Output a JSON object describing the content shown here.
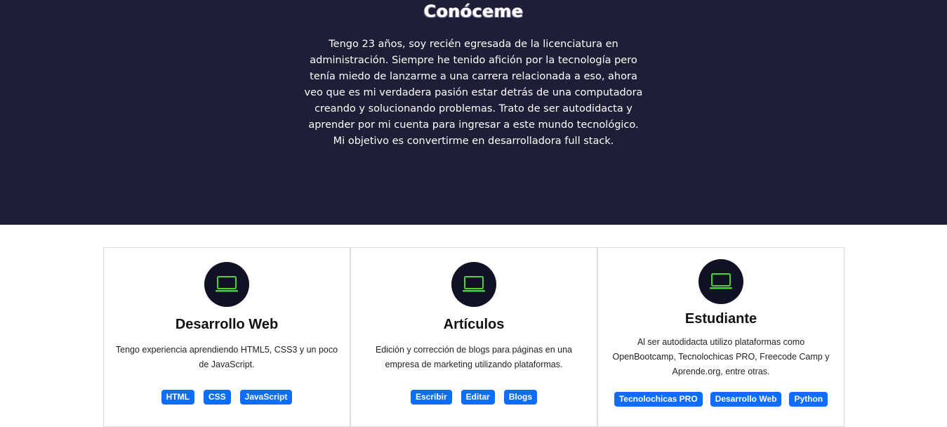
{
  "about": {
    "title": "Conóceme",
    "paragraph": "Tengo 23 años, soy recién egresada de la licenciatura en administración. Siempre he tenido afición por la tecnología pero tenía miedo de lanzarme a una carrera relacionada a eso, ahora veo que es mi verdadera pasión estar detrás de una computadora creando y solucionando problemas. Trato de ser autodidacta y aprender por mi cuenta para ingresar a este mundo tecnológico. Mi objetivo es convertirme en desarrolladora full stack."
  },
  "cards": [
    {
      "icon": "laptop-icon",
      "title": "Desarrollo Web",
      "text": "Tengo experiencia aprendiendo HTML5, CSS3 y un poco de JavaScript.",
      "tags": [
        "HTML",
        "CSS",
        "JavaScript"
      ]
    },
    {
      "icon": "laptop-icon",
      "title": "Artículos",
      "text": "Edición y corrección de blogs para páginas en una empresa de marketing utilizando plataformas.",
      "tags": [
        "Escribir",
        "Editar",
        "Blogs"
      ]
    },
    {
      "icon": "laptop-icon",
      "title": "Estudiante",
      "text": "Al ser autodidacta utilizo plataformas como OpenBootcamp, Tecnolochicas PRO, Freecode Camp y Aprende.org, entre otras.",
      "tags": [
        "Tecnolochicas PRO",
        "Desarrollo Web",
        "Python"
      ]
    }
  ],
  "colors": {
    "hero_bg": "#1e1f37",
    "icon_circle": "#0f1125",
    "icon_accent": "#4cd137",
    "tag_bg": "#0d6efd"
  }
}
